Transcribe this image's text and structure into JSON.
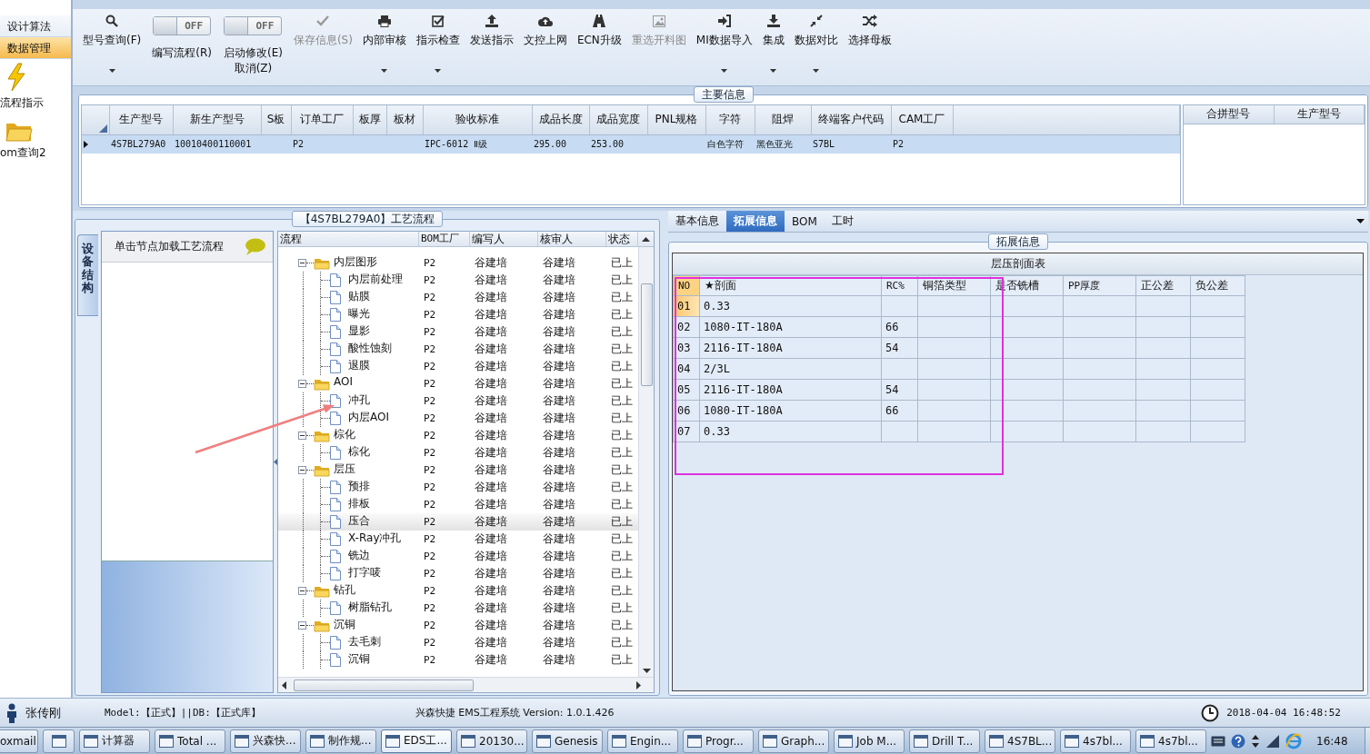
{
  "sidebar": {
    "items": [
      {
        "kind": "plain",
        "label": "设计算法",
        "selected": false
      },
      {
        "kind": "plain",
        "label": "数据管理",
        "selected": true
      },
      {
        "kind": "launcher",
        "label": "流程指示",
        "selected": false
      },
      {
        "kind": "launcher",
        "label": "om查询2",
        "selected": false
      }
    ]
  },
  "toolbar": {
    "items": [
      {
        "kind": "button",
        "label": "型号查询(F)",
        "dropdown": true,
        "disabled": false
      },
      {
        "kind": "toggle",
        "label": "编写流程(R)",
        "toggle_text": "OFF",
        "on": false
      },
      {
        "kind": "toggle",
        "label": "启动修改(E)",
        "sublabel": "取消(Z)",
        "toggle_text": "OFF",
        "on": false
      },
      {
        "kind": "button",
        "label": "保存信息(S)",
        "dropdown": false,
        "disabled": true
      },
      {
        "kind": "button",
        "label": "内部审核",
        "dropdown": true,
        "disabled": false
      },
      {
        "kind": "button",
        "label": "指示检查",
        "dropdown": true,
        "disabled": false
      },
      {
        "kind": "button",
        "label": "发送指示",
        "dropdown": false,
        "disabled": false
      },
      {
        "kind": "button",
        "label": "文控上网",
        "dropdown": false,
        "disabled": false
      },
      {
        "kind": "button",
        "label": "ECN升级",
        "dropdown": false,
        "disabled": false
      },
      {
        "kind": "button",
        "label": "重选开料图",
        "dropdown": false,
        "disabled": true
      },
      {
        "kind": "button",
        "label": "MI数据导入",
        "dropdown": true,
        "disabled": false
      },
      {
        "kind": "button",
        "label": "集成",
        "dropdown": true,
        "disabled": false
      },
      {
        "kind": "button",
        "label": "数据对比",
        "dropdown": true,
        "disabled": false
      },
      {
        "kind": "button",
        "label": "选择母板",
        "dropdown": false,
        "disabled": false
      }
    ]
  },
  "main_info": {
    "legend": "主要信息",
    "columns": [
      "生产型号",
      "新生产型号",
      "S板",
      "订单工厂",
      "板厚",
      "板材",
      "验收标准",
      "成品长度",
      "成品宽度",
      "PNL规格",
      "字符",
      "阻焊",
      "终端客户代码",
      "CAM工厂"
    ],
    "rows": [
      {
        "selected": true,
        "cells": [
          "4S7BL279A0",
          "10010400110001",
          null,
          "P2",
          null,
          null,
          "IPC-6012 Ⅱ级",
          "295.00",
          "253.00",
          null,
          "白色字符",
          "黑色亚光",
          "S7BL",
          "P2"
        ]
      }
    ],
    "side_table": {
      "columns": [
        "合拼型号",
        "生产型号"
      ]
    }
  },
  "flow": {
    "legend": "【4S7BL279A0】工艺流程",
    "side_tab": "设备结构",
    "hint": "单击节点加载工艺流程",
    "columns": [
      "流程",
      "BOM工厂",
      "编写人",
      "核审人",
      "状态"
    ],
    "tree": [
      {
        "name": "内层图形",
        "bom": "P2",
        "writer": "谷建培",
        "reviewer": "谷建培",
        "status": "已上",
        "expanded": true,
        "selected": false,
        "children": [
          {
            "name": "内层前处理",
            "bom": "P2",
            "writer": "谷建培",
            "reviewer": "谷建培",
            "status": "已上",
            "selected": false
          },
          {
            "name": "贴膜",
            "bom": "P2",
            "writer": "谷建培",
            "reviewer": "谷建培",
            "status": "已上",
            "selected": false
          },
          {
            "name": "曝光",
            "bom": "P2",
            "writer": "谷建培",
            "reviewer": "谷建培",
            "status": "已上",
            "selected": false
          },
          {
            "name": "显影",
            "bom": "P2",
            "writer": "谷建培",
            "reviewer": "谷建培",
            "status": "已上",
            "selected": false
          },
          {
            "name": "酸性蚀刻",
            "bom": "P2",
            "writer": "谷建培",
            "reviewer": "谷建培",
            "status": "已上",
            "selected": false
          },
          {
            "name": "退膜",
            "bom": "P2",
            "writer": "谷建培",
            "reviewer": "谷建培",
            "status": "已上",
            "selected": false
          }
        ]
      },
      {
        "name": "AOI",
        "bom": "P2",
        "writer": "谷建培",
        "reviewer": "谷建培",
        "status": "已上",
        "expanded": true,
        "selected": false,
        "children": [
          {
            "name": "冲孔",
            "bom": "P2",
            "writer": "谷建培",
            "reviewer": "谷建培",
            "status": "已上",
            "selected": false
          },
          {
            "name": "内层AOI",
            "bom": "P2",
            "writer": "谷建培",
            "reviewer": "谷建培",
            "status": "已上",
            "selected": false
          }
        ]
      },
      {
        "name": "棕化",
        "bom": "P2",
        "writer": "谷建培",
        "reviewer": "谷建培",
        "status": "已上",
        "expanded": true,
        "selected": false,
        "children": [
          {
            "name": "棕化",
            "bom": "P2",
            "writer": "谷建培",
            "reviewer": "谷建培",
            "status": "已上",
            "selected": false
          }
        ]
      },
      {
        "name": "层压",
        "bom": "P2",
        "writer": "谷建培",
        "reviewer": "谷建培",
        "status": "已上",
        "expanded": true,
        "selected": false,
        "children": [
          {
            "name": "预排",
            "bom": "P2",
            "writer": "谷建培",
            "reviewer": "谷建培",
            "status": "已上",
            "selected": false
          },
          {
            "name": "排板",
            "bom": "P2",
            "writer": "谷建培",
            "reviewer": "谷建培",
            "status": "已上",
            "selected": false
          },
          {
            "name": "压合",
            "bom": "P2",
            "writer": "谷建培",
            "reviewer": "谷建培",
            "status": "已上",
            "selected": true
          },
          {
            "name": "X-Ray冲孔",
            "bom": "P2",
            "writer": "谷建培",
            "reviewer": "谷建培",
            "status": "已上",
            "selected": false
          },
          {
            "name": "铣边",
            "bom": "P2",
            "writer": "谷建培",
            "reviewer": "谷建培",
            "status": "已上",
            "selected": false
          },
          {
            "name": "打字唛",
            "bom": "P2",
            "writer": "谷建培",
            "reviewer": "谷建培",
            "status": "已上",
            "selected": false
          }
        ]
      },
      {
        "name": "钻孔",
        "bom": "P2",
        "writer": "谷建培",
        "reviewer": "谷建培",
        "status": "已上",
        "expanded": true,
        "selected": false,
        "children": [
          {
            "name": "树脂钻孔",
            "bom": "P2",
            "writer": "谷建培",
            "reviewer": "谷建培",
            "status": "已上",
            "selected": false
          }
        ]
      },
      {
        "name": "沉铜",
        "bom": "P2",
        "writer": "谷建培",
        "reviewer": "谷建培",
        "status": "已上",
        "expanded": true,
        "selected": false,
        "children": [
          {
            "name": "去毛刺",
            "bom": "P2",
            "writer": "谷建培",
            "reviewer": "谷建培",
            "status": "已上",
            "selected": false
          },
          {
            "name": "沉铜",
            "bom": "P2",
            "writer": "谷建培",
            "reviewer": "谷建培",
            "status": "已上",
            "selected": false
          }
        ]
      }
    ]
  },
  "ext": {
    "tabs": [
      {
        "label": "基本信息",
        "selected": false
      },
      {
        "label": "拓展信息",
        "selected": true
      },
      {
        "label": "BOM",
        "selected": false
      },
      {
        "label": "工时",
        "selected": false
      }
    ],
    "legend": "拓展信息",
    "table": {
      "title": "层压剖面表",
      "columns": [
        "NO",
        "★剖面",
        "RC%",
        "铜箔类型",
        "是否铣槽",
        "PP厚度",
        "正公差",
        "负公差"
      ],
      "rows": [
        {
          "selected": true,
          "cells": [
            "01",
            "0.33",
            null,
            null,
            null,
            null,
            null,
            null
          ]
        },
        {
          "selected": false,
          "cells": [
            "02",
            "1080-IT-180A",
            "66",
            null,
            null,
            null,
            null,
            null
          ]
        },
        {
          "selected": false,
          "cells": [
            "03",
            "2116-IT-180A",
            "54",
            null,
            null,
            null,
            null,
            null
          ]
        },
        {
          "selected": false,
          "cells": [
            "04",
            "2/3L",
            null,
            null,
            null,
            null,
            null,
            null
          ]
        },
        {
          "selected": false,
          "cells": [
            "05",
            "2116-IT-180A",
            "54",
            null,
            null,
            null,
            null,
            null
          ]
        },
        {
          "selected": false,
          "cells": [
            "06",
            "1080-IT-180A",
            "66",
            null,
            null,
            null,
            null,
            null
          ]
        },
        {
          "selected": false,
          "cells": [
            "07",
            "0.33",
            null,
            null,
            null,
            null,
            null,
            null
          ]
        }
      ]
    }
  },
  "status_bar": {
    "user": "张传刚",
    "model": "Model:【正式】||DB:【正式库】",
    "app": "兴森快捷 EMS工程系统 Version: 1.0.1.426",
    "datetime": "2018-04-04 16:48:52"
  },
  "taskbar": {
    "items": [
      {
        "label": "oxmail",
        "selected": false
      },
      {
        "selected": false
      },
      {
        "label": "计算器",
        "selected": false
      },
      {
        "label": "Total ...",
        "selected": false
      },
      {
        "label": "兴森快...",
        "selected": false
      },
      {
        "label": "制作规...",
        "selected": false
      },
      {
        "label": "EDS工...",
        "selected": true
      },
      {
        "label": "20130...",
        "selected": false
      },
      {
        "label": "Genesis",
        "selected": false
      },
      {
        "label": "Engin...",
        "selected": false
      },
      {
        "label": "Progr...",
        "selected": false
      },
      {
        "label": "Graph...",
        "selected": false
      },
      {
        "label": "Job M...",
        "selected": false
      },
      {
        "label": "Drill T...",
        "selected": false
      },
      {
        "label": "4S7BL...",
        "selected": false
      },
      {
        "label": "4s7bl...",
        "selected": false
      },
      {
        "label": "4s7bl...",
        "selected": false
      }
    ],
    "clock": "16:48"
  },
  "annotations": {
    "arrow": true,
    "frame": true
  }
}
